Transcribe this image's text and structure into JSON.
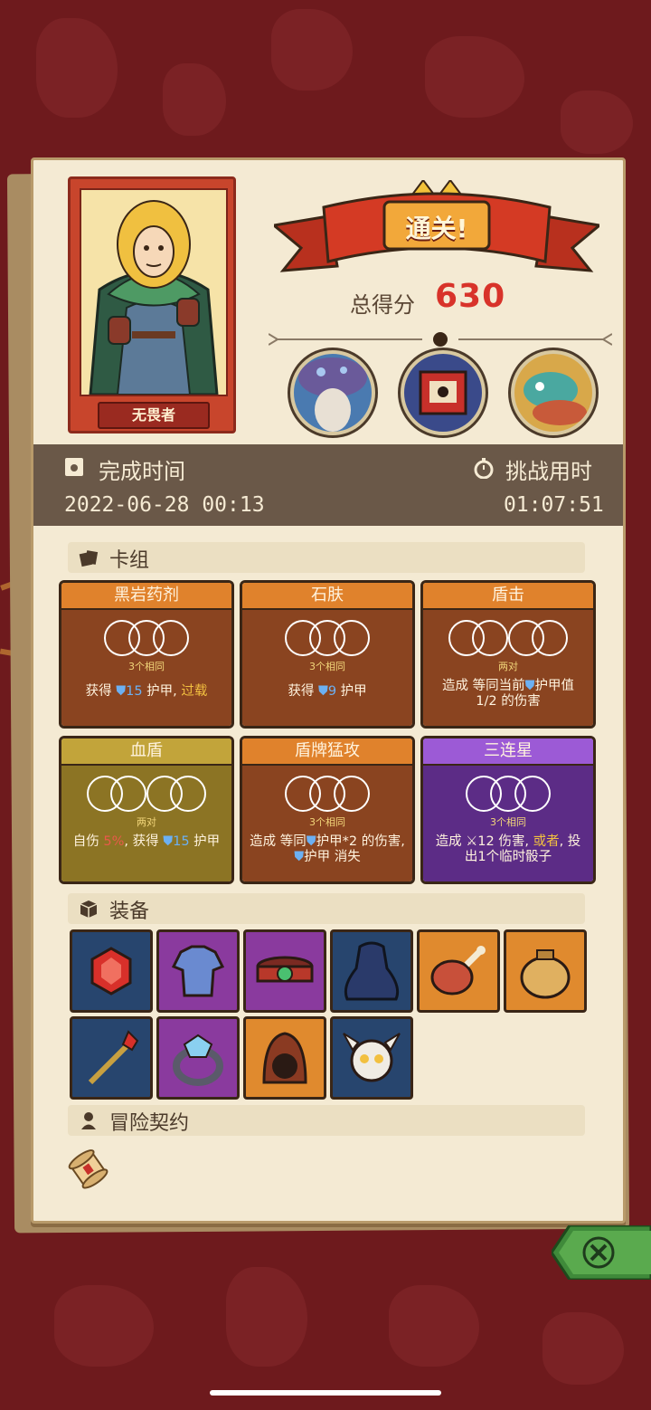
{
  "hero": {
    "name": "无畏者"
  },
  "banner": {
    "title": "通关!"
  },
  "score": {
    "label": "总得分",
    "value": "630"
  },
  "times": {
    "finish_label": "完成时间",
    "finish_value": "2022-06-28 00:13",
    "challenge_label": "挑战用时",
    "challenge_value": "01:07:51"
  },
  "sections": {
    "deck": "卡组",
    "equipment": "装备",
    "contract": "冒险契约"
  },
  "cards": [
    {
      "title": "黑岩药剂",
      "sub": "3个相同",
      "desc_a": "获得 ",
      "shield": "15",
      "desc_b": " 护甲, ",
      "desc_c": "过载"
    },
    {
      "title": "石肤",
      "sub": "3个相同",
      "desc_a": "获得 ",
      "shield": "9",
      "desc_b": " 护甲"
    },
    {
      "title": "盾击",
      "sub": "两对",
      "desc_a": "造成 等同当前",
      "desc_b": "护甲值 1/2 的伤害"
    },
    {
      "title": "血盾",
      "sub": "两对",
      "desc_a": "自伤 ",
      "desc_pct": "5%",
      "desc_b": ", 获得 ",
      "shield": "15",
      "desc_c": " 护甲"
    },
    {
      "title": "盾牌猛攻",
      "sub": "3个相同",
      "desc_a": "造成 等同",
      "desc_b": "护甲*2 的伤害, ",
      "desc_c": "护甲 消失"
    },
    {
      "title": "三连星",
      "sub": "3个相同",
      "desc_a": "造成 ",
      "dmg": "12",
      "desc_b": " 伤害, ",
      "desc_c": "或者",
      "desc_d": ", 投出1个临时骰子"
    }
  ],
  "equipment": [
    "ruby-gem",
    "blue-tunic",
    "red-belt",
    "dark-cloak",
    "ham-leg",
    "coin-sack",
    "ruby-scepter",
    "diamond-ring",
    "brown-hood",
    "skull-helmet"
  ],
  "colors": {
    "accent_red": "#d8332a",
    "background": "#6e1a1d",
    "panel": "#f4ead3"
  }
}
